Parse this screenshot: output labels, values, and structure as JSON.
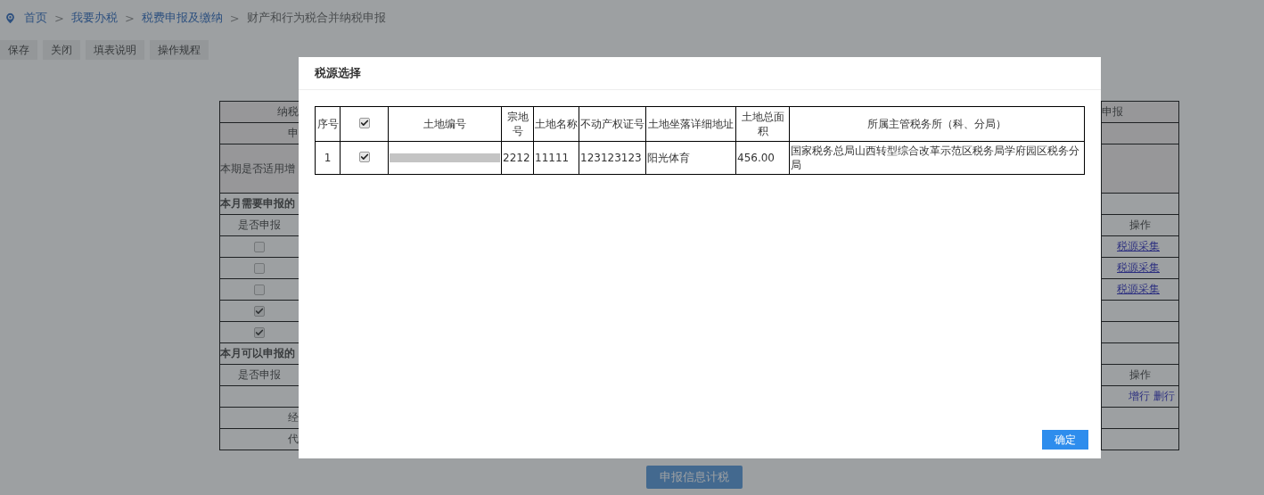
{
  "breadcrumb": [
    {
      "kind": "link",
      "label": "首页"
    },
    {
      "kind": "separator",
      "label": ">"
    },
    {
      "kind": "link",
      "label": "我要办税"
    },
    {
      "kind": "separator",
      "label": ">"
    },
    {
      "kind": "link",
      "label": "税费申报及缴纳"
    },
    {
      "kind": "separator",
      "label": ">"
    },
    {
      "kind": "current",
      "label": "财产和行为税合并纳税申报"
    }
  ],
  "toolbar": [
    "保存",
    "关闭",
    "填表说明",
    "操作规程"
  ],
  "form_rows": [
    {
      "kind": "label",
      "left": "纳税",
      "right": "申报",
      "shaded": true
    },
    {
      "kind": "label",
      "left": "申",
      "shaded": true
    },
    {
      "kind": "question",
      "left": "本期是否适用增",
      "shaded": true
    },
    {
      "kind": "section",
      "left": "本月需要申报的"
    },
    {
      "kind": "column_header",
      "left": "是否申报",
      "right": "操作"
    },
    {
      "kind": "item",
      "checked": false,
      "links": [
        "税源采集"
      ]
    },
    {
      "kind": "item",
      "checked": false,
      "links": [
        "税源采集"
      ]
    },
    {
      "kind": "item",
      "checked": false,
      "links": [
        "税源采集"
      ]
    },
    {
      "kind": "item",
      "checked": true
    },
    {
      "kind": "item",
      "checked": true
    },
    {
      "kind": "section",
      "left": "本月可以申报的"
    },
    {
      "kind": "column_header",
      "left": "是否申报",
      "right": "操作"
    },
    {
      "kind": "actions",
      "links": [
        "增行",
        "删行"
      ]
    },
    {
      "kind": "label",
      "left": "经"
    },
    {
      "kind": "label",
      "left": "代"
    }
  ],
  "submit_button": "申报信息计税",
  "dialog": {
    "title": "税源选择",
    "columns": [
      "序号",
      "",
      "土地编号",
      "宗地号",
      "土地名称",
      "不动产权证号",
      "土地坐落详细地址",
      "土地总面积",
      "所属主管税务所（科、分局）"
    ],
    "header_checked": true,
    "rows": [
      {
        "cells": [
          "1",
          "",
          "",
          "2212",
          "11111",
          "123123123",
          "阳光体育",
          "456.00",
          "国家税务总局山西转型综合改革示范区税务局学府园区税务分局"
        ],
        "checked": true,
        "redacted": true
      }
    ],
    "confirm_button": "确定"
  }
}
